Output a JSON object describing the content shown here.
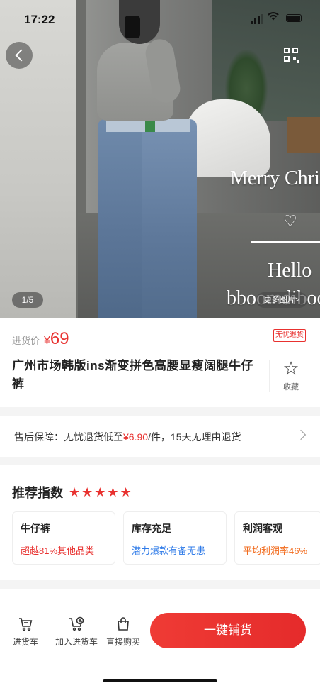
{
  "status_bar": {
    "time": "17:22"
  },
  "hero": {
    "image_counter": "1/5",
    "more_images_label": "更多图片>",
    "overlay_lines": [
      "Merry Chris",
      "♡",
      "Hello",
      "bboomdiboo"
    ]
  },
  "product": {
    "price_label": "进货价",
    "currency": "¥",
    "price": "69",
    "return_badge": "无忧退货",
    "title": "广州市场韩版ins渐变拼色高腰显瘦阔腿牛仔裤",
    "favorite_label": "收藏"
  },
  "after_sales": {
    "prefix": "售后保障：无忧退货低至",
    "amount": "¥6.90",
    "suffix": "/件，15天无理由退货"
  },
  "recommendation": {
    "title": "推荐指数",
    "stars": 5,
    "stars_text": "★★★★★",
    "cards": [
      {
        "title": "牛仔裤",
        "subtitle": "超越81%其他品类"
      },
      {
        "title": "库存充足",
        "subtitle": "潜力爆款有备无患"
      },
      {
        "title": "利润客观",
        "subtitle": "平均利润率46%"
      }
    ]
  },
  "bottom_bar": {
    "cart_label": "进货车",
    "add_to_cart_label": "加入进货车",
    "buy_now_label": "直接购买",
    "cta_label": "一键铺货"
  },
  "colors": {
    "accent_red": "#e8312f",
    "blue": "#2f7be8",
    "orange": "#f26b1d"
  }
}
